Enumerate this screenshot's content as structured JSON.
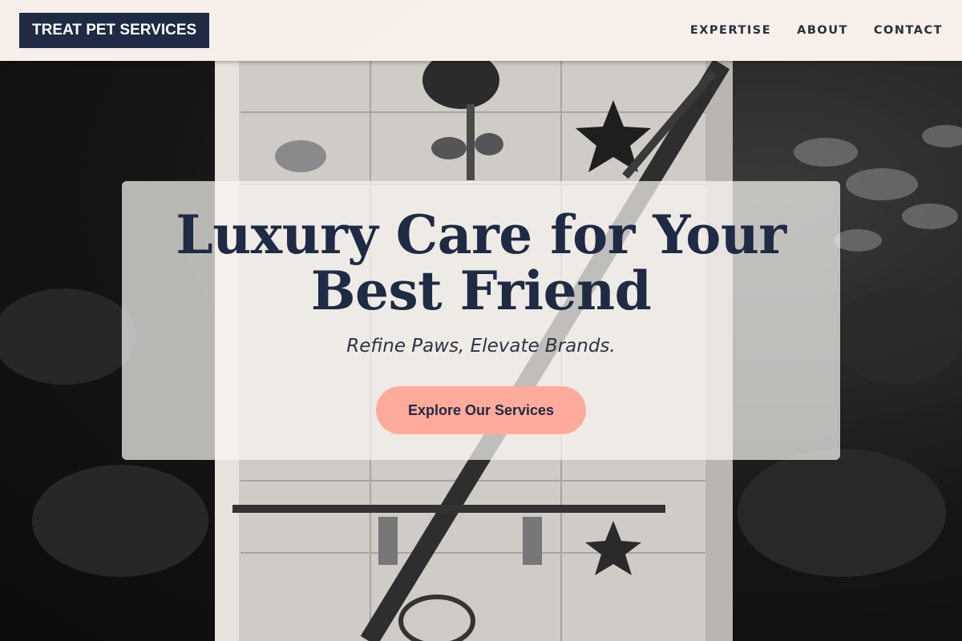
{
  "header": {
    "logo": "TREAT PET SERVICES",
    "nav": [
      "EXPERTISE",
      "ABOUT",
      "CONTACT"
    ]
  },
  "hero": {
    "title": "Luxury Care for Your Best Friend",
    "subtitle": "Refine Paws, Elevate Brands.",
    "cta_label": "Explore Our Services",
    "background": "grayscale photo of a painted birdhouse with branches and ivy"
  },
  "colors": {
    "navy": "#1f2a44",
    "cta_background": "#ffab9b",
    "header_background": "#fdf6f1"
  }
}
